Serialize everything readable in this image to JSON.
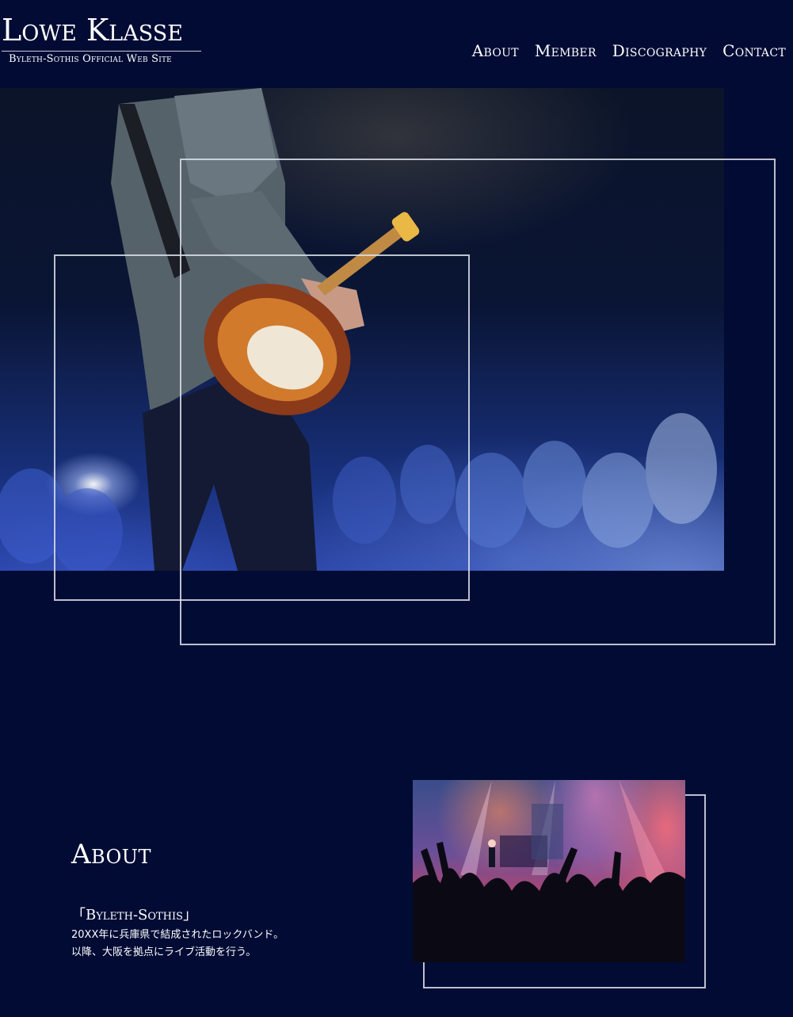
{
  "header": {
    "logo_title": "Lowe Klasse",
    "logo_subtitle": "Byleth-Sothis Official Web Site"
  },
  "nav": {
    "items": [
      {
        "label": "About"
      },
      {
        "label": "Member"
      },
      {
        "label": "Discography"
      },
      {
        "label": "Contact"
      }
    ]
  },
  "about": {
    "heading": "About",
    "band_name": "「Byleth-Sothis」",
    "description_lines": [
      "20XX年に兵庫県で結成されたロックバンド。",
      "以降、大阪を拠点にライブ活動を行う。"
    ]
  },
  "colors": {
    "background": "#010b34",
    "text": "#ffffff",
    "frame": "#dcdfe8"
  }
}
